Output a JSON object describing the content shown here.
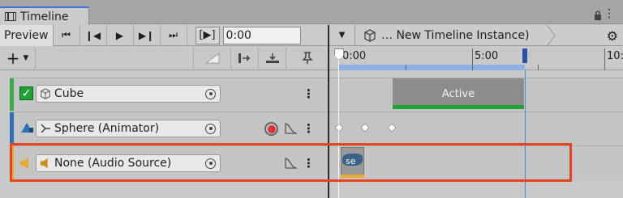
{
  "window": {
    "tab_title": "Timeline"
  },
  "toolbar": {
    "preview_label": "Preview",
    "buttons": [
      "⏮",
      "❙◀",
      "▶",
      "▶❙",
      "⏭"
    ],
    "play_range_label": "[▶]",
    "current_time": "0:00"
  },
  "header": {
    "breadcrumb": "… New Timeline Instance)"
  },
  "add_button": {
    "label": "+"
  },
  "ruler": {
    "ticks": [
      "0:00",
      "5:00",
      "10:"
    ]
  },
  "tracks": [
    {
      "name": "Cube",
      "color": "#3aa84a",
      "type": "activation",
      "muted_checkbox": "✓"
    },
    {
      "name": "Sphere (Animator)",
      "color": "#2e6fb8",
      "type": "animation"
    },
    {
      "name": "None (Audio Source)",
      "color": "#e9a830",
      "type": "audio"
    }
  ],
  "clips": {
    "active_label": "Active",
    "audio_label": "se"
  },
  "colors": {
    "accent_blue": "#3a72d8",
    "highlight_red": "#e8421f",
    "active_green": "#21a037"
  }
}
